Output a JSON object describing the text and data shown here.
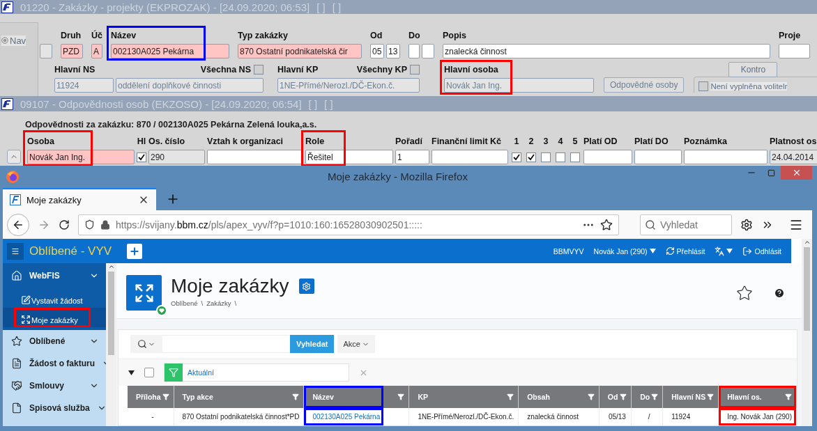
{
  "projects_form": {
    "title": "01220 - Zakázky - projekty (EKPROZAK) - [24.09.2020; 06:53]",
    "markers": [
      "[ ]",
      "[ ]"
    ],
    "nav": {
      "label": "Nav",
      "checked": true
    },
    "row1": [
      {
        "inputs": [
          {
            "kind": "readonly"
          }
        ]
      },
      {
        "label": "Druh",
        "inputs": [
          {
            "kind": "required",
            "value": "PZD"
          }
        ]
      },
      {
        "label": "Úč",
        "inputs": [
          {
            "kind": "required",
            "value": "A"
          }
        ]
      },
      {
        "label": "Název",
        "color": "#0000ff",
        "inputs": [
          {
            "kind": "required",
            "value": "002130A025 Pekárna"
          }
        ]
      },
      {
        "label": "Typ zakázky",
        "inputs": [
          {
            "kind": "required",
            "value": "870 Ostatní podnikatelská čir"
          }
        ]
      },
      {
        "label": "Od",
        "inputs": [
          {
            "kind": "input",
            "value": "05"
          },
          {
            "kind": "input",
            "value": "13"
          }
        ]
      },
      {
        "label": "Do",
        "inputs": [
          {
            "kind": "input"
          },
          {
            "kind": "input"
          }
        ]
      },
      {
        "label": "Popis",
        "inputs": [
          {
            "kind": "input",
            "value": "znalecká činnost"
          }
        ]
      },
      {
        "label": "Proje",
        "inputs": [
          {
            "kind": "input"
          }
        ]
      }
    ],
    "row2": [
      {
        "label": "Hlavní NS",
        "option": {
          "label": "Všechna NS",
          "checked": false
        },
        "inputs": [
          {
            "kind": "readonly",
            "value": "11924"
          },
          {
            "kind": "readonly",
            "value": "oddělení doplňkové činnosti"
          }
        ]
      },
      {
        "label": "Hlavní KP",
        "option": {
          "label": "Všechny KP",
          "checked": false
        },
        "inputs": [
          {
            "kind": "readonly",
            "value": "1NE-Přímé/Nerozl./DČ-Ekon.č."
          }
        ]
      },
      {
        "label": "Hlavní osoba",
        "color": "#ff0000",
        "inputs": [
          {
            "kind": "readonly",
            "value": "Novák Jan Ing."
          }
        ]
      }
    ],
    "responsible_button": "Odpovědné osoby",
    "check_panel": {
      "button": "Kontro",
      "option": {
        "label": "Není vyplněna volitelr",
        "checked": false
      }
    }
  },
  "responsibilities_form": {
    "title": "09107 - Odpovědnosti osob (EKZOSO) - [24.09.2020; 06:54]",
    "markers": [
      "[ ]",
      "[ ]"
    ],
    "heading": "Odpovědnosti za zakázku: 870 / 002130A025 Pekárna Zelená louka,a.s.",
    "columns": [
      {
        "label": "Osoba",
        "kind": "required",
        "value": "Novák Jan Ing.",
        "color": "#ff0000"
      },
      {
        "label": "Hl",
        "kind": "checkbox",
        "checked": true
      },
      {
        "label": "Os. číslo",
        "kind": "readonly",
        "value": "290"
      },
      {
        "label": "Vztah k organizaci",
        "kind": "input"
      },
      {
        "label": "Role",
        "kind": "input",
        "value": "Řešitel",
        "color": "#ff0000"
      },
      {
        "label": "Pořadí",
        "kind": "input",
        "value": "1"
      },
      {
        "label": "Finanční limit Kč",
        "kind": "input"
      },
      {
        "label": "1",
        "kind": "checkbox",
        "checked": true
      },
      {
        "label": "2",
        "kind": "checkbox",
        "checked": true
      },
      {
        "label": "3",
        "kind": "checkbox",
        "checked": false
      },
      {
        "label": "4",
        "kind": "checkbox",
        "checked": false
      },
      {
        "label": "5",
        "kind": "checkbox",
        "checked": false
      },
      {
        "label": "Platí OD",
        "kind": "input"
      },
      {
        "label": "Platí DO",
        "kind": "input"
      },
      {
        "label": "Poznámka",
        "kind": "input"
      },
      {
        "label": "Platnost os",
        "kind": "readonly",
        "value": "24.04.2014"
      }
    ]
  },
  "browser": {
    "window_title": "Moje zakázky - Mozilla Firefox",
    "tab": "Moje zakázky",
    "url": {
      "scheme": "https://svijany.",
      "domain": "bbm.cz",
      "path": "/pls/apex_vyv/f?p=1010:160:16528030902501:::::"
    },
    "search_placeholder": "Vyhledat"
  },
  "app": {
    "title": "Oblíbené - VYV",
    "user_links": [
      {
        "kind": "text",
        "label": "BBMVYV"
      },
      {
        "kind": "menu",
        "label": "Novák Jan (290)"
      },
      {
        "kind": "relogin",
        "label": "Přehlásit"
      },
      {
        "kind": "language"
      },
      {
        "kind": "logout",
        "label": "Odhlásit"
      }
    ],
    "sidebar": [
      {
        "kind": "home",
        "label": "WebFIS",
        "expanded": true,
        "children": [
          {
            "kind": "edit",
            "label": "Vystavit žádost",
            "selected": false
          },
          {
            "kind": "projects",
            "label": "Moje zakázky",
            "selected": true,
            "color": "#ff0000"
          }
        ]
      },
      {
        "kind": "star",
        "label": "Oblíbené",
        "expanded": false
      },
      {
        "kind": "invoice",
        "label": "Žádost o fakturu",
        "expanded": false
      },
      {
        "kind": "contracts",
        "label": "Smlouvy",
        "expanded": false
      },
      {
        "kind": "documents",
        "label": "Spisová služba",
        "expanded": false
      }
    ],
    "page": {
      "title": "Moje zakázky",
      "breadcrumb": [
        "Oblíbené",
        "Zakázky"
      ],
      "separator": "\\",
      "search_button": "Vyhledat",
      "actions": "Akce",
      "filter": {
        "label": "Aktuální",
        "checked": false
      },
      "table": {
        "columns": [
          {
            "label": "Příloha"
          },
          {
            "label": "Typ akce"
          },
          {
            "label": "Název",
            "kind": "link",
            "color": "#0000ff"
          },
          {
            "label": "KP"
          },
          {
            "label": "Obsah"
          },
          {
            "label": "Od"
          },
          {
            "label": "Do"
          },
          {
            "label": "Hlavní NS"
          },
          {
            "label": "Hlavní os.",
            "color": "#ff0000"
          }
        ],
        "rows": [
          [
            "-",
            "870 Ostatní podnikatelská činnost*PD",
            "002130A025 Pekárna",
            "1NE-Přímé/Nerozl./DČ-Ekon.č.",
            "znalecká činnost",
            "05/13",
            "/",
            "11924",
            "Ing. Novák Jan (290)"
          ]
        ]
      }
    }
  }
}
